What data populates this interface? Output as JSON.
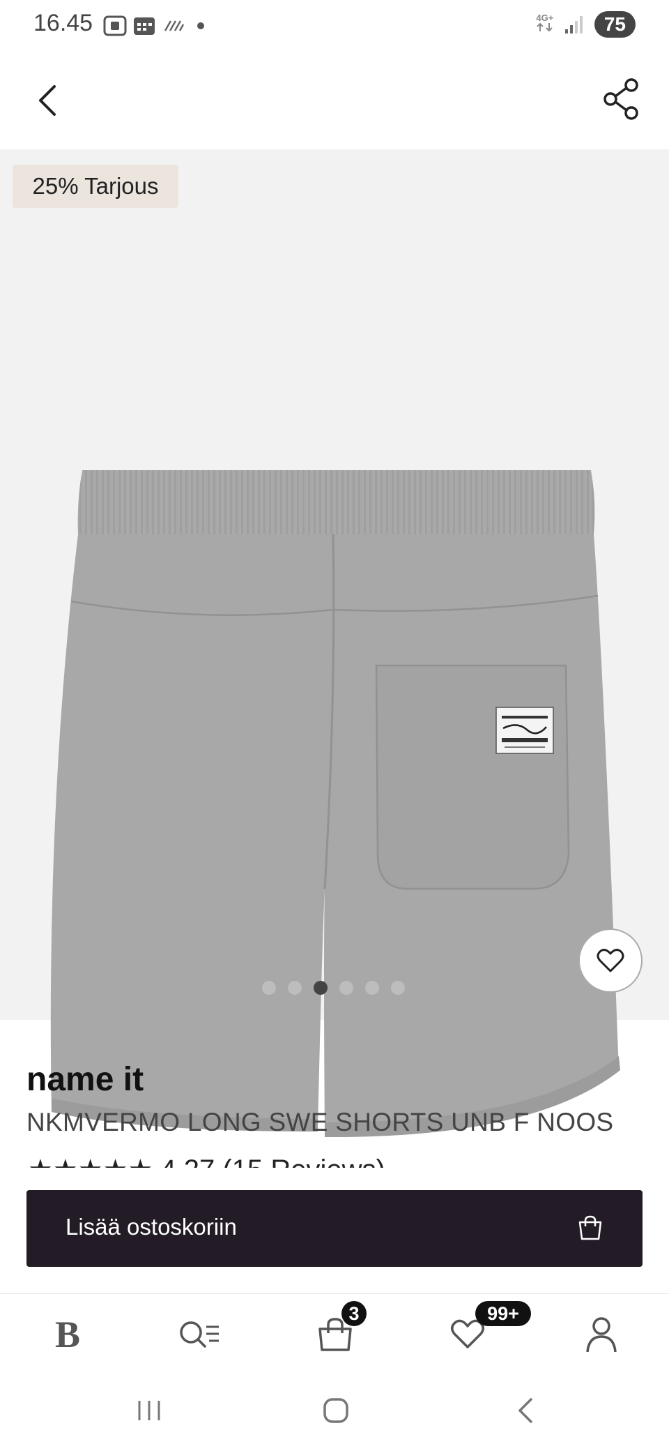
{
  "status_bar": {
    "time": "16.45",
    "network": "4G+",
    "battery": "75"
  },
  "product": {
    "offer_badge": "25% Tarjous",
    "brand": "name it",
    "name": "NKMVERMO LONG SWE SHORTS UNB F NOOS",
    "rating": "4.27",
    "reviews": "(15 Reviews)",
    "image_count": 6,
    "active_image": 3
  },
  "cta": {
    "label": "Lisää ostoskoriin"
  },
  "bottom_nav": {
    "items": [
      {
        "icon": "brand-logo-icon",
        "label": "B"
      },
      {
        "icon": "search-list-icon"
      },
      {
        "icon": "shopping-bag-icon",
        "badge": "3"
      },
      {
        "icon": "heart-icon",
        "badge": "99+"
      },
      {
        "icon": "profile-icon"
      }
    ]
  },
  "colors": {
    "cta_bg": "#231c26",
    "badge_bg": "#ebe5de",
    "image_bg": "#f2f2f2"
  }
}
